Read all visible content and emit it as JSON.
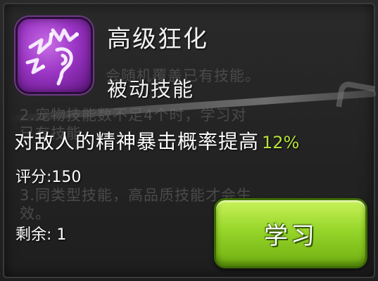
{
  "skill": {
    "name": "高级狂化",
    "type": "被动技能",
    "icon": "berserk-lightning-icon"
  },
  "effect": {
    "text": "对敌人的精神暴击概率提高",
    "value": "12%"
  },
  "score_text": "评分:150",
  "remaining_text": "剩余: 1",
  "learn_button": {
    "label": "学习"
  },
  "background_notes": {
    "line1": "会随机覆盖已有技能。",
    "line2": "2.宠物技能数不足4个时，学习对",
    "line3": "已有技能。",
    "line4": "3.同类型技能，高品质技能才会生",
    "line5": "效。"
  },
  "colors": {
    "highlight": "#b6e23a",
    "button": "#97d62a",
    "icon_bg": "#9a35c4"
  }
}
